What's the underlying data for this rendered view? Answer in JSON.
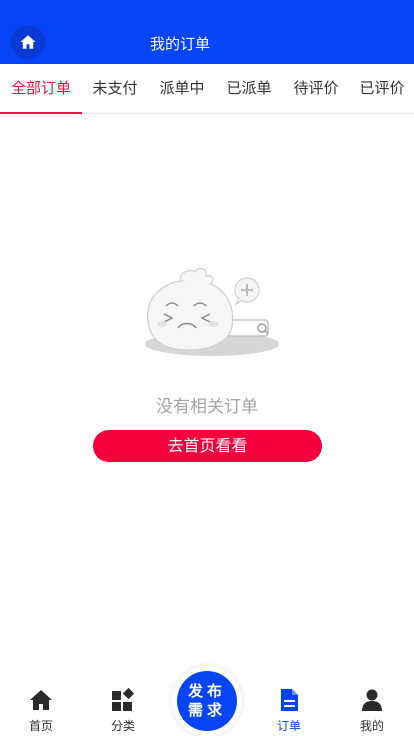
{
  "header": {
    "title": "我的订单",
    "home_icon": "home-icon"
  },
  "tabs": [
    {
      "label": "全部订单",
      "active": true
    },
    {
      "label": "未支付",
      "active": false
    },
    {
      "label": "派单中",
      "active": false
    },
    {
      "label": "已派单",
      "active": false
    },
    {
      "label": "待评价",
      "active": false
    },
    {
      "label": "已评价",
      "active": false
    }
  ],
  "empty": {
    "illustration": "empty-bun-search-illustration",
    "message": "没有相关订单",
    "cta_label": "去首页看看"
  },
  "bottom_nav": {
    "items": [
      {
        "label": "首页",
        "icon": "home-icon"
      },
      {
        "label": "分类",
        "icon": "category-icon"
      },
      {
        "label": "订单",
        "icon": "order-document-icon",
        "active": true
      },
      {
        "label": "我的",
        "icon": "user-icon"
      }
    ],
    "publish": {
      "line1": "发布",
      "line2": "需求"
    }
  },
  "colors": {
    "primary": "#0645f5",
    "accent_red": "#e6163e",
    "cta_red": "#f5003b",
    "muted_text": "#a5a5a5"
  }
}
